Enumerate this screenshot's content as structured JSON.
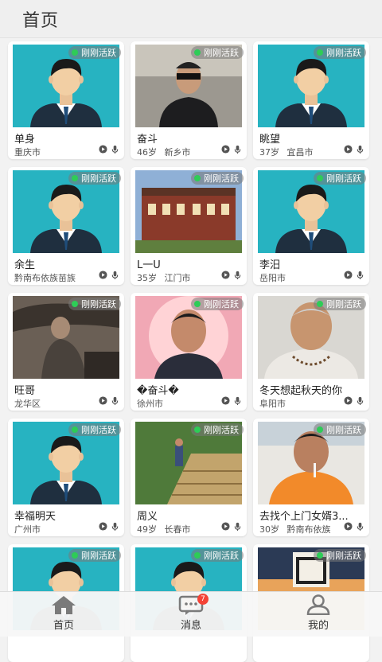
{
  "header": {
    "title": "首页"
  },
  "badge_text": "刚刚活跃",
  "cards": [
    {
      "name": "单身",
      "age": "",
      "city": "重庆市",
      "photo": "avatar"
    },
    {
      "name": "奋斗",
      "age": "46岁",
      "city": "新乡市",
      "photo": "photo-man-car"
    },
    {
      "name": "眺望",
      "age": "37岁",
      "city": "宜昌市",
      "photo": "avatar"
    },
    {
      "name": "余生",
      "age": "",
      "city": "黔南布依族苗族",
      "photo": "avatar"
    },
    {
      "name": "L一U",
      "age": "35岁",
      "city": "江门市",
      "photo": "photo-building"
    },
    {
      "name": "李汨",
      "age": "",
      "city": "岳阳市",
      "photo": "avatar"
    },
    {
      "name": "旺哥",
      "age": "",
      "city": "龙华区",
      "photo": "photo-man-rocks"
    },
    {
      "name": "�奋斗�",
      "age": "",
      "city": "徐州市",
      "photo": "photo-man-portrait"
    },
    {
      "name": "冬天想起秋天的你",
      "age": "",
      "city": "阜阳市",
      "photo": "photo-man-white"
    },
    {
      "name": "幸福明天",
      "age": "",
      "city": "广州市",
      "photo": "avatar"
    },
    {
      "name": "周义",
      "age": "49岁",
      "city": "长春市",
      "photo": "photo-stairs"
    },
    {
      "name": "去找个上门女婿3...",
      "age": "30岁",
      "city": "黔南布依族",
      "photo": "photo-man-smoking"
    },
    {
      "name": "",
      "age": "",
      "city": "",
      "photo": "avatar"
    },
    {
      "name": "",
      "age": "",
      "city": "",
      "photo": "avatar"
    },
    {
      "name": "",
      "age": "",
      "city": "",
      "photo": "photo-poster"
    }
  ],
  "tabbar": {
    "items": [
      {
        "label": "首页",
        "icon": "home-icon"
      },
      {
        "label": "消息",
        "icon": "message-icon",
        "badge": "7"
      },
      {
        "label": "我的",
        "icon": "profile-icon"
      }
    ]
  },
  "colors": {
    "avatar_bg": "#27b3c1",
    "online": "#2ecc57",
    "notif": "#f44336"
  }
}
